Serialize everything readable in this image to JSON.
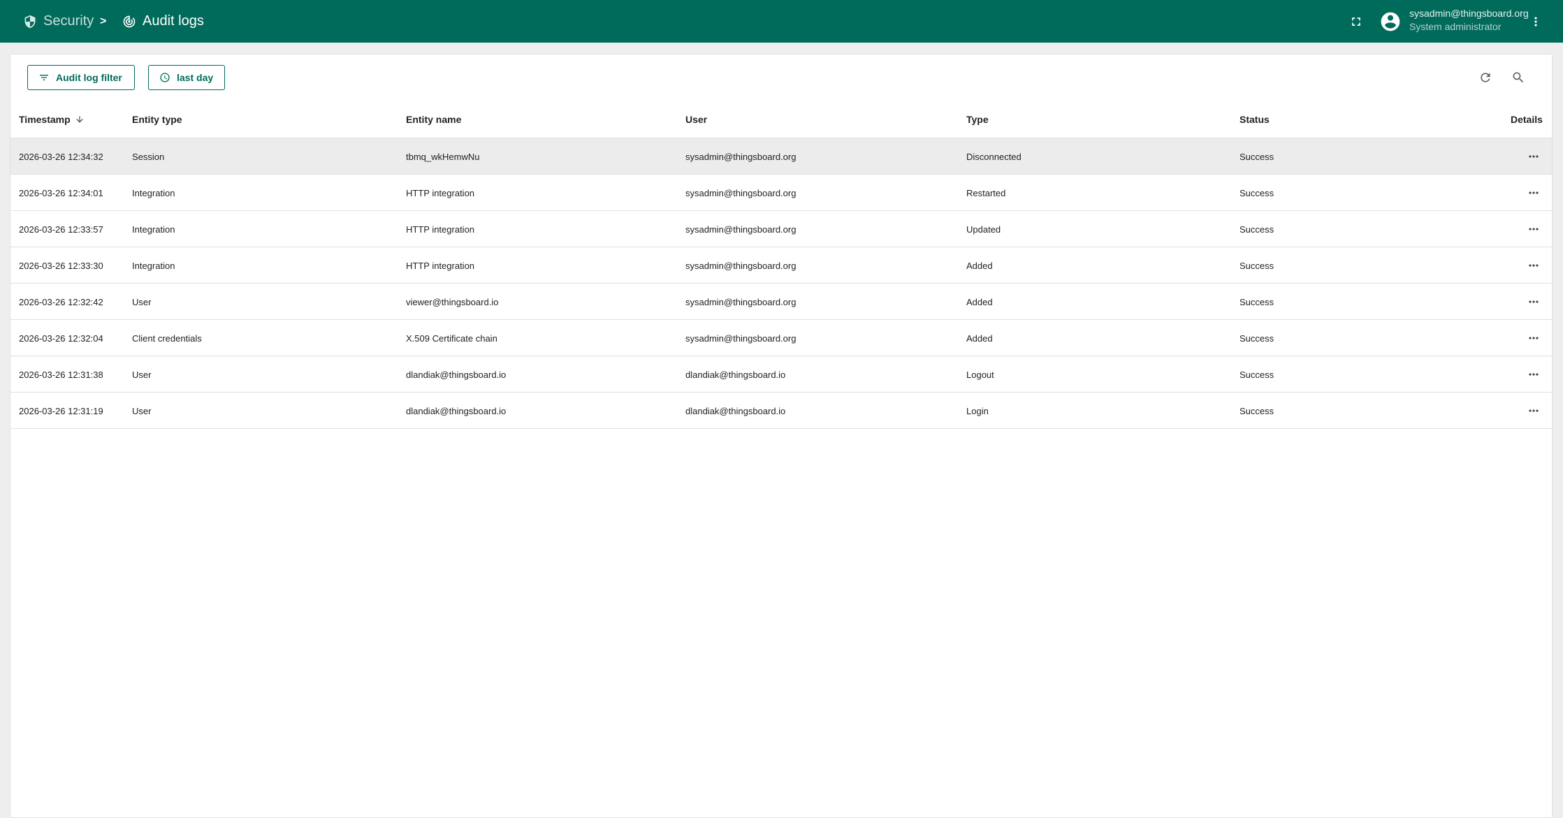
{
  "breadcrumb": {
    "parent": "Security",
    "separator": ">",
    "current": "Audit logs",
    "parent_icon": "shield-icon",
    "current_icon": "track-changes-icon"
  },
  "topbar": {
    "background": "#006a5b",
    "user_email": "sysadmin@thingsboard.org",
    "user_role": "System administrator"
  },
  "toolbar": {
    "filter_label": "Audit log filter",
    "time_label": "last day"
  },
  "table": {
    "columns": {
      "timestamp": "Timestamp",
      "entity_type": "Entity type",
      "entity_name": "Entity name",
      "user": "User",
      "type": "Type",
      "status": "Status",
      "details": "Details"
    },
    "sort": {
      "column": "timestamp",
      "direction": "desc"
    },
    "rows": [
      {
        "timestamp": "2026-03-26 12:34:32",
        "entity_type": "Session",
        "entity_name": "tbmq_wkHemwNu",
        "user": "sysadmin@thingsboard.org",
        "type": "Disconnected",
        "status": "Success"
      },
      {
        "timestamp": "2026-03-26 12:34:01",
        "entity_type": "Integration",
        "entity_name": "HTTP integration",
        "user": "sysadmin@thingsboard.org",
        "type": "Restarted",
        "status": "Success"
      },
      {
        "timestamp": "2026-03-26 12:33:57",
        "entity_type": "Integration",
        "entity_name": "HTTP integration",
        "user": "sysadmin@thingsboard.org",
        "type": "Updated",
        "status": "Success"
      },
      {
        "timestamp": "2026-03-26 12:33:30",
        "entity_type": "Integration",
        "entity_name": "HTTP integration",
        "user": "sysadmin@thingsboard.org",
        "type": "Added",
        "status": "Success"
      },
      {
        "timestamp": "2026-03-26 12:32:42",
        "entity_type": "User",
        "entity_name": "viewer@thingsboard.io",
        "user": "sysadmin@thingsboard.org",
        "type": "Added",
        "status": "Success"
      },
      {
        "timestamp": "2026-03-26 12:32:04",
        "entity_type": "Client credentials",
        "entity_name": "X.509 Certificate chain",
        "user": "sysadmin@thingsboard.org",
        "type": "Added",
        "status": "Success"
      },
      {
        "timestamp": "2026-03-26 12:31:38",
        "entity_type": "User",
        "entity_name": "dlandiak@thingsboard.io",
        "user": "dlandiak@thingsboard.io",
        "type": "Logout",
        "status": "Success"
      },
      {
        "timestamp": "2026-03-26 12:31:19",
        "entity_type": "User",
        "entity_name": "dlandiak@thingsboard.io",
        "user": "dlandiak@thingsboard.io",
        "type": "Login",
        "status": "Success"
      }
    ]
  }
}
